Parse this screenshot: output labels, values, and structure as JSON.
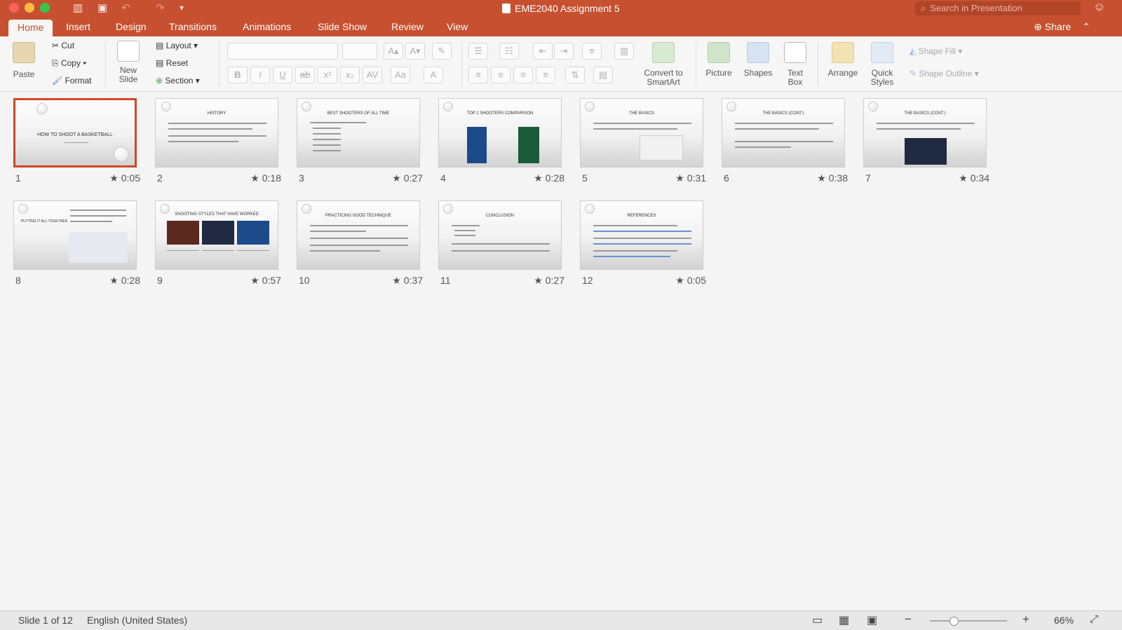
{
  "window": {
    "title": "EME2040 Assignment 5",
    "search_placeholder": "Search in Presentation"
  },
  "tabs": [
    "Home",
    "Insert",
    "Design",
    "Transitions",
    "Animations",
    "Slide Show",
    "Review",
    "View"
  ],
  "share_label": "Share",
  "ribbon": {
    "paste": "Paste",
    "cut": "Cut",
    "copy": "Copy",
    "format": "Format",
    "new_slide_1": "New",
    "new_slide_2": "Slide",
    "layout": "Layout",
    "reset": "Reset",
    "section": "Section",
    "convert_1": "Convert to",
    "convert_2": "SmartArt",
    "picture": "Picture",
    "shapes": "Shapes",
    "textbox_1": "Text",
    "textbox_2": "Box",
    "arrange": "Arrange",
    "quick_1": "Quick",
    "quick_2": "Styles",
    "shape_fill": "Shape Fill",
    "shape_outline": "Shape Outline"
  },
  "slides": [
    {
      "num": "1",
      "time": "0:05",
      "title": "HOW TO SHOOT A BASKETBALL"
    },
    {
      "num": "2",
      "time": "0:18",
      "title": "HISTORY"
    },
    {
      "num": "3",
      "time": "0:27",
      "title": "BEST SHOOTERS OF ALL TIME"
    },
    {
      "num": "4",
      "time": "0:28",
      "title": "TOP 2 SHOOTERS COMPARISON"
    },
    {
      "num": "5",
      "time": "0:31",
      "title": "THE BASICS"
    },
    {
      "num": "6",
      "time": "0:38",
      "title": "THE BASICS (CONT.)"
    },
    {
      "num": "7",
      "time": "0:34",
      "title": "THE BASICS (CONT.)"
    },
    {
      "num": "8",
      "time": "0:28",
      "title": "PUTTING IT ALL TOGETHER"
    },
    {
      "num": "9",
      "time": "0:57",
      "title": "SHOOTING STYLES THAT HAVE WORKED"
    },
    {
      "num": "10",
      "time": "0:37",
      "title": "PRACTICING GOOD TECHNIQUE"
    },
    {
      "num": "11",
      "time": "0:27",
      "title": "CONCLUSION"
    },
    {
      "num": "12",
      "time": "0:05",
      "title": "REFERENCES"
    }
  ],
  "status": {
    "slide_of": "Slide 1 of 12",
    "language": "English (United States)",
    "zoom": "66%"
  },
  "colors": {
    "accent": "#c6502f",
    "selection": "#d24726"
  }
}
